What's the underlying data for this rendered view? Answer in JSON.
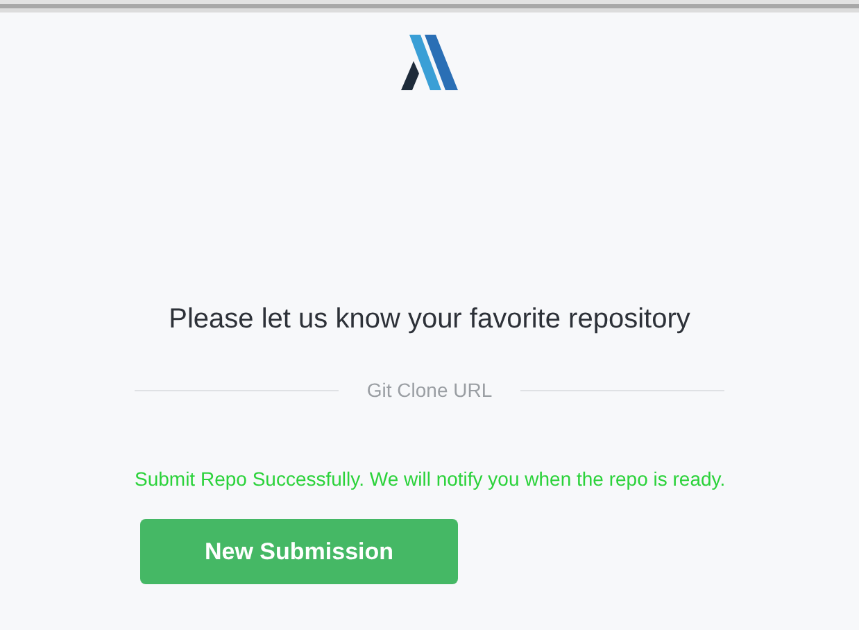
{
  "heading": "Please let us know your favorite repository",
  "divider_label": "Git Clone URL",
  "success_message": "Submit Repo Successfully. We will notify you when the repo is ready.",
  "button": {
    "label": "New Submission"
  }
}
